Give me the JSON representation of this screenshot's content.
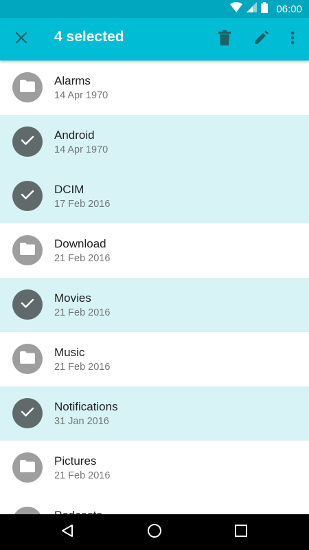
{
  "status_bar": {
    "time": "06:00",
    "icons": [
      "wifi-icon",
      "cell-signal-icon",
      "battery-icon"
    ]
  },
  "app_bar": {
    "title": "4 selected",
    "background": "#00bcd4",
    "actions": [
      "close-icon",
      "delete-icon",
      "edit-icon",
      "more-vert-icon"
    ]
  },
  "files": [
    {
      "name": "Alarms",
      "date": "14 Apr 1970",
      "selected": false
    },
    {
      "name": "Android",
      "date": "14 Apr 1970",
      "selected": true
    },
    {
      "name": "DCIM",
      "date": "17 Feb 2016",
      "selected": true
    },
    {
      "name": "Download",
      "date": "21 Feb 2016",
      "selected": false
    },
    {
      "name": "Movies",
      "date": "21 Feb 2016",
      "selected": true
    },
    {
      "name": "Music",
      "date": "21 Feb 2016",
      "selected": false
    },
    {
      "name": "Notifications",
      "date": "31 Jan 2016",
      "selected": true
    },
    {
      "name": "Pictures",
      "date": "21 Feb 2016",
      "selected": false
    },
    {
      "name": "Podcasts",
      "date": "",
      "selected": false
    }
  ],
  "colors": {
    "selected_row": "#d7f3f6",
    "selected_avatar": "#616a6b",
    "folder_avatar": "#9e9e9e"
  },
  "nav_bar": {
    "buttons": [
      "back-icon",
      "home-icon",
      "recents-icon"
    ]
  }
}
